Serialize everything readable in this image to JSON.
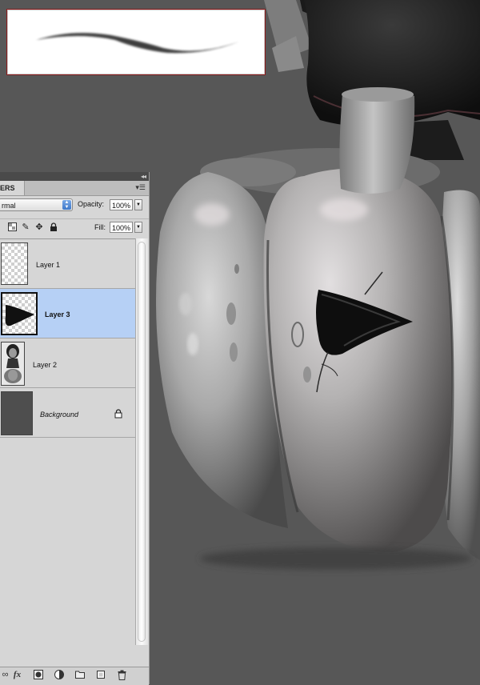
{
  "layers_panel": {
    "tab_label": "ERS",
    "blend_mode": "rmal",
    "opacity_label": "Opacity:",
    "opacity_value": "100%",
    "lock_label": ":",
    "fill_label": "Fill:",
    "fill_value": "100%",
    "layers": [
      {
        "name": "Layer 1",
        "thumb": "transparent-checker",
        "selected": false
      },
      {
        "name": "Layer 3",
        "thumb": "dark-triangle-eye",
        "selected": true
      },
      {
        "name": "Layer 2",
        "thumb": "girl-with-pumpkin",
        "selected": false
      },
      {
        "name": "Background",
        "thumb": "dark-gray-fill",
        "selected": false,
        "locked": true
      }
    ],
    "selection_color": "#b6d0f5",
    "bottom_icons": [
      "link-layers-icon",
      "fx-icon",
      "layer-mask-icon",
      "adjustment-layer-icon",
      "group-folder-icon",
      "new-layer-icon",
      "trash-icon"
    ]
  },
  "brush_preview": {
    "border_color": "#8b1a1a"
  },
  "canvas": {
    "background_color": "#575757",
    "subject": "grayscale painted pumpkin"
  }
}
